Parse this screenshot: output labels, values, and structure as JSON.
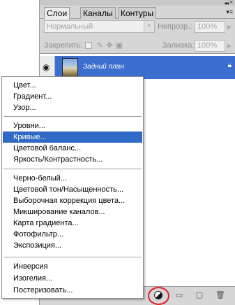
{
  "panel": {
    "tabs": [
      {
        "label": "Слои"
      },
      {
        "label": "Каналы"
      },
      {
        "label": "Контуры"
      }
    ],
    "blend_mode": "Нормальный",
    "opacity_label": "Непрозр.:",
    "opacity_value": "100%",
    "lock_label": "Закрепить:",
    "fill_label": "Заливка:",
    "fill_value": "100%",
    "layer": {
      "name": "Задний план"
    },
    "icons": {
      "eye": "eye-icon",
      "lock": "lock-icon",
      "adjustment": "adjustment-layer-icon",
      "group": "folder-icon",
      "new": "new-layer-icon",
      "trash": "trash-icon"
    },
    "selection_color": "#3a6fd0",
    "annotation_color": "#e02020"
  },
  "menu": {
    "items": [
      {
        "label": "Цвет..."
      },
      {
        "label": "Градиент..."
      },
      {
        "label": "Узор..."
      },
      {
        "label": "Уровни..."
      },
      {
        "label": "Кривые..."
      },
      {
        "label": "Цветовой баланс..."
      },
      {
        "label": "Яркость/Контрастность..."
      },
      {
        "label": "Черно-белый..."
      },
      {
        "label": "Цветовой тон/Насыщенность..."
      },
      {
        "label": "Выборочная коррекция цвета..."
      },
      {
        "label": "Микширование каналов..."
      },
      {
        "label": "Карта градиента..."
      },
      {
        "label": "Фотофильтр..."
      },
      {
        "label": "Экспозиция..."
      },
      {
        "label": "Инверсия"
      },
      {
        "label": "Изогелия..."
      },
      {
        "label": "Постеризовать..."
      }
    ],
    "highlighted": "Кривые..."
  }
}
